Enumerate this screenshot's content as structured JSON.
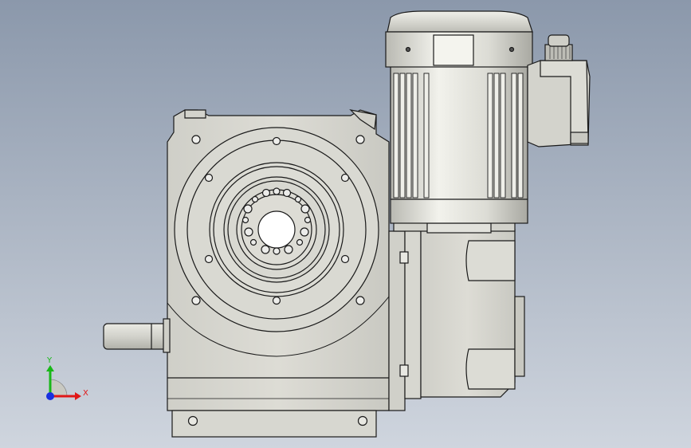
{
  "viewport": {
    "background_top": "#8b98ab",
    "background_bottom": "#cfd5de"
  },
  "model": {
    "body_color": "#d6d6d0",
    "edge_color": "#1a1a1a"
  },
  "triad": {
    "x_label": "X",
    "y_label": "Y",
    "x_color": "#e01818",
    "y_color": "#18b818",
    "z_color": "#1830e0"
  }
}
